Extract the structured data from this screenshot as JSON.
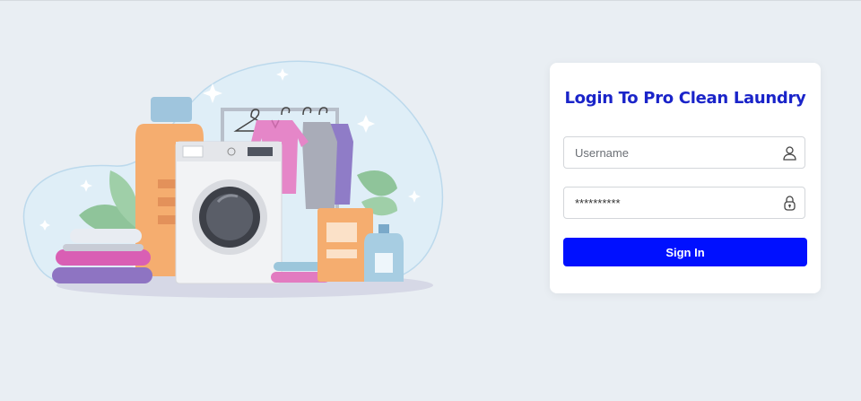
{
  "login": {
    "title": "Login To Pro Clean Laundry",
    "username_placeholder": "Username",
    "password_value": "**********",
    "signin_label": "Sign In"
  },
  "icons": {
    "username": "user-icon",
    "password": "lock-icon",
    "illustration": "laundry-illustration"
  },
  "colors": {
    "page_background": "#e9eef3",
    "title": "#1a24c9",
    "button": "#0010ff"
  }
}
